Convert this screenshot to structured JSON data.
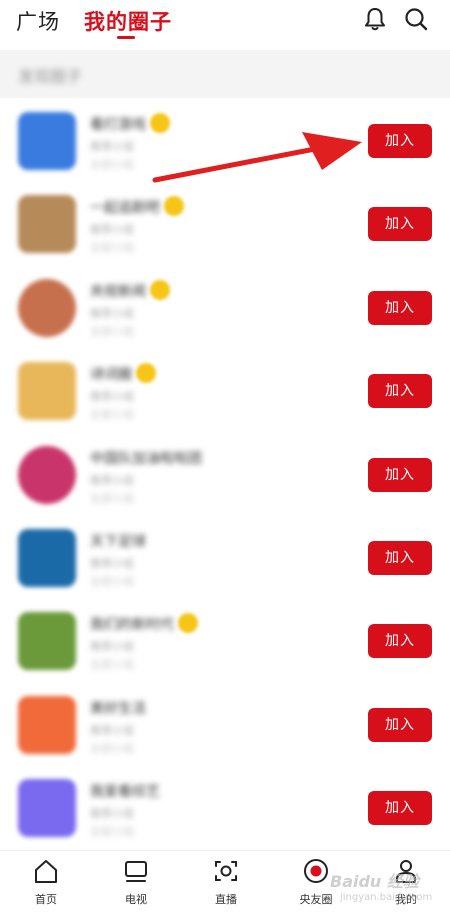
{
  "header": {
    "tab_plaza": "广场",
    "tab_mine": "我的圈子"
  },
  "section": {
    "title": "发现圈子"
  },
  "join_label": "加入",
  "circles": [
    {
      "name": "看打游戏",
      "desc1": "推荐小组",
      "desc2": "全部小组",
      "avatar_color": "#3a7be0"
    },
    {
      "name": "一起追剧吧",
      "desc1": "推荐小组",
      "desc2": "全部小组",
      "avatar_color": "#b78a5a"
    },
    {
      "name": "央视新闻",
      "desc1": "推荐小组",
      "desc2": "全部小组",
      "avatar_color": "#c7704d"
    },
    {
      "name": "诗词圈",
      "desc1": "推荐小组",
      "desc2": "全部小组",
      "avatar_color": "#e8b75a"
    },
    {
      "name": "中国队加油啦啦团",
      "desc1": "推荐小组",
      "desc2": "全部小组",
      "avatar_color": "#c9356a"
    },
    {
      "name": "天下足球",
      "desc1": "推荐小组",
      "desc2": "全部小组",
      "avatar_color": "#1b6aa8"
    },
    {
      "name": "我们的新时代",
      "desc1": "推荐小组",
      "desc2": "全部小组",
      "avatar_color": "#6a9a3a"
    },
    {
      "name": "美好生活",
      "desc1": "推荐小组",
      "desc2": "全部小组",
      "avatar_color": "#f06a3a"
    },
    {
      "name": "我爱看综艺",
      "desc1": "推荐小组",
      "desc2": "全部小组",
      "avatar_color": "#7a6af0"
    }
  ],
  "bottom_nav": {
    "home": "首页",
    "tv": "电视",
    "live": "直播",
    "circle": "央友圈",
    "mine": "我的"
  },
  "watermark": {
    "brand": "Baidu 经验",
    "sub": "jingyan.baidu.com"
  },
  "colors": {
    "accent": "#d60f1b",
    "badge": "#f5c518"
  }
}
